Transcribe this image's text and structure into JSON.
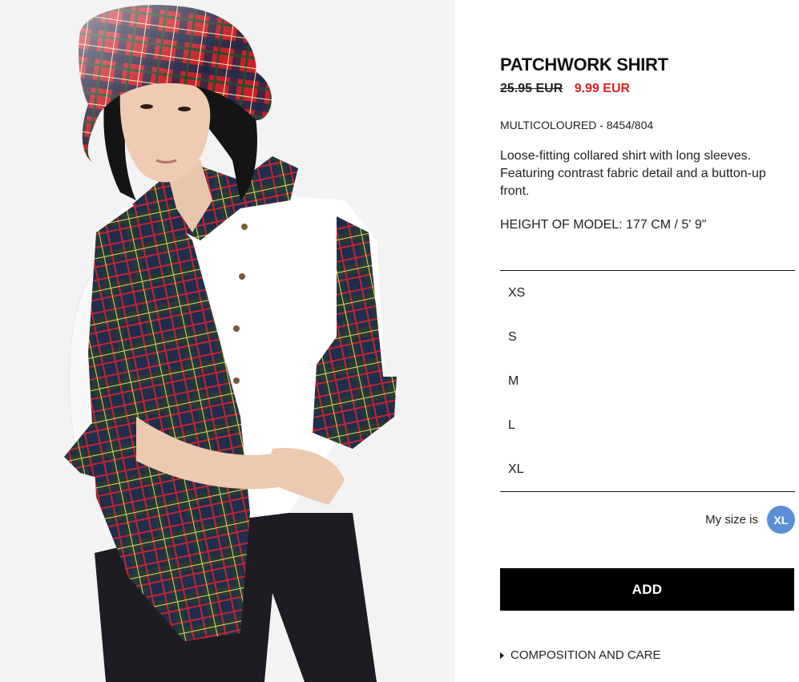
{
  "product": {
    "name": "PATCHWORK SHIRT",
    "price_old": "25.95 EUR",
    "price_new": "9.99 EUR",
    "color_ref": "MULTICOLOURED - 8454/804",
    "description": "Loose-fitting collared shirt with long sleeves. Featuring contrast fabric detail and a button-up front.",
    "model_height": "HEIGHT OF MODEL: 177 CM / 5' 9\""
  },
  "sizes": [
    "XS",
    "S",
    "M",
    "L",
    "XL"
  ],
  "my_size": {
    "label": "My size is",
    "value": "XL"
  },
  "actions": {
    "add_label": "ADD",
    "composition_label": "COMPOSITION AND CARE"
  },
  "icons": {
    "composition": "caret-right-icon"
  },
  "colors": {
    "sale_price": "#e02020",
    "add_button": "#000000",
    "size_badge": "#5a8fd4"
  }
}
